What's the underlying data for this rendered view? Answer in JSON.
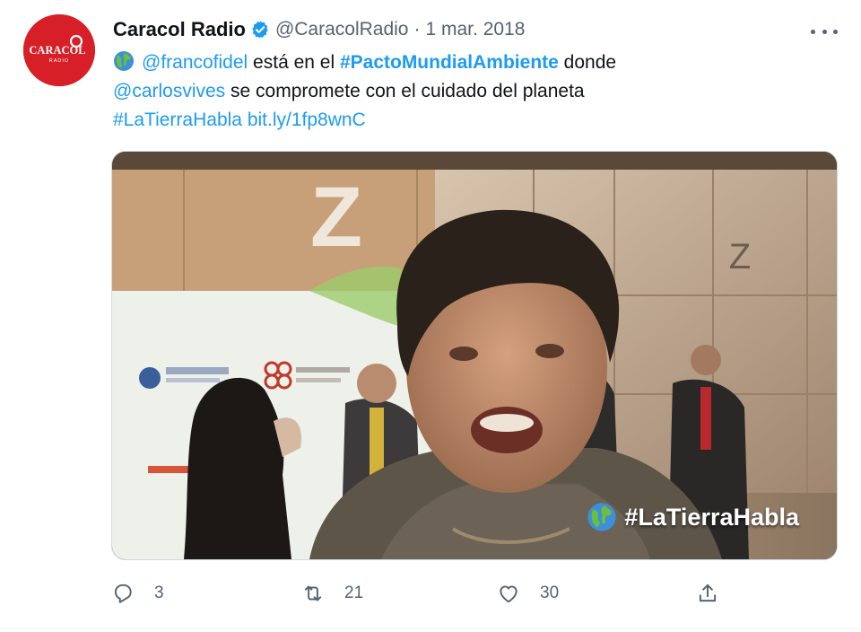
{
  "tweet": {
    "author_name": "Caracol Radio",
    "author_handle": "@CaracolRadio",
    "separator": "·",
    "date": "1 mar. 2018",
    "avatar_logo_text": "CARACOL",
    "avatar_logo_subtext": "RADIO",
    "verified": true,
    "text": {
      "mention_1": "@francofidel",
      "plain_1": " está en el ",
      "hashtag_1": "#PactoMundialAmbiente",
      "plain_2": " donde",
      "mention_2": "@carlosvives",
      "plain_3": " se compromete con el cuidado del planeta",
      "hashtag_2": "#LaTierraHabla",
      "link": "bit.ly/1fp8wnC"
    },
    "media": {
      "type": "video-still",
      "overlay_hashtag": "#LaTierraHabla",
      "backdrop_letters": [
        "Z",
        "Z"
      ]
    },
    "actions": {
      "reply_count": "3",
      "retweet_count": "21",
      "like_count": "30"
    }
  },
  "icons": {
    "globe": "globe-emoji-icon",
    "verified": "verified-badge-icon",
    "more": "more-dots-icon",
    "reply": "reply-icon",
    "retweet": "retweet-icon",
    "like": "heart-icon",
    "share": "share-icon"
  },
  "colors": {
    "link": "#1d9bf0",
    "secondary_text": "#536471",
    "avatar_bg": "#d61f26"
  }
}
